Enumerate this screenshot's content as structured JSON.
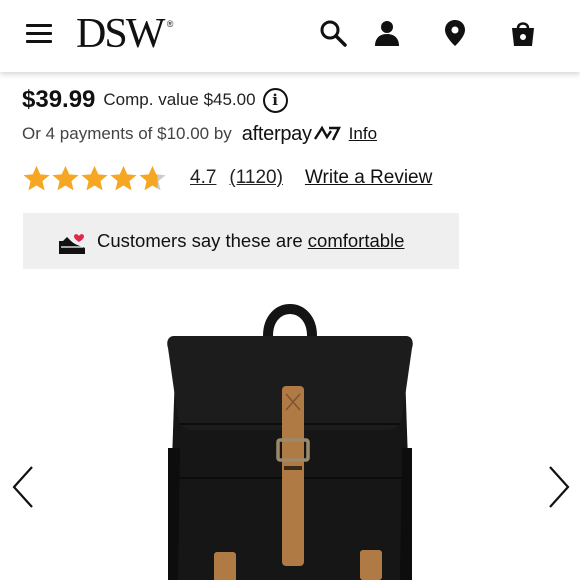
{
  "header": {
    "logo": "DSW",
    "logo_mark": "®",
    "icons": [
      "menu-icon",
      "search-icon",
      "account-icon",
      "location-pin-icon",
      "shopping-bag-icon"
    ]
  },
  "pricing": {
    "price": "$39.99",
    "comp_value": "Comp. value $45.00",
    "info_glyph": "i"
  },
  "payments": {
    "text": "Or 4 payments of $10.00 by",
    "provider": "afterpay",
    "info_link": "Info"
  },
  "rating": {
    "stars": 4.7,
    "value": "4.7",
    "count": "(1120)",
    "write_review": "Write a Review",
    "star_color": "#f5a623",
    "empty_color": "#cccccc"
  },
  "banner": {
    "text": "Customers say these are ",
    "link": "comfortable",
    "background": "#efefef",
    "icon": "comfort-shoe-heart-icon",
    "heart_color": "#e0284b"
  },
  "gallery": {
    "prev": "chevron-left-icon",
    "next": "chevron-right-icon",
    "product_colors": {
      "body": "#141414",
      "strap": "#b07a45",
      "buckle": "#9a8a6a"
    }
  }
}
